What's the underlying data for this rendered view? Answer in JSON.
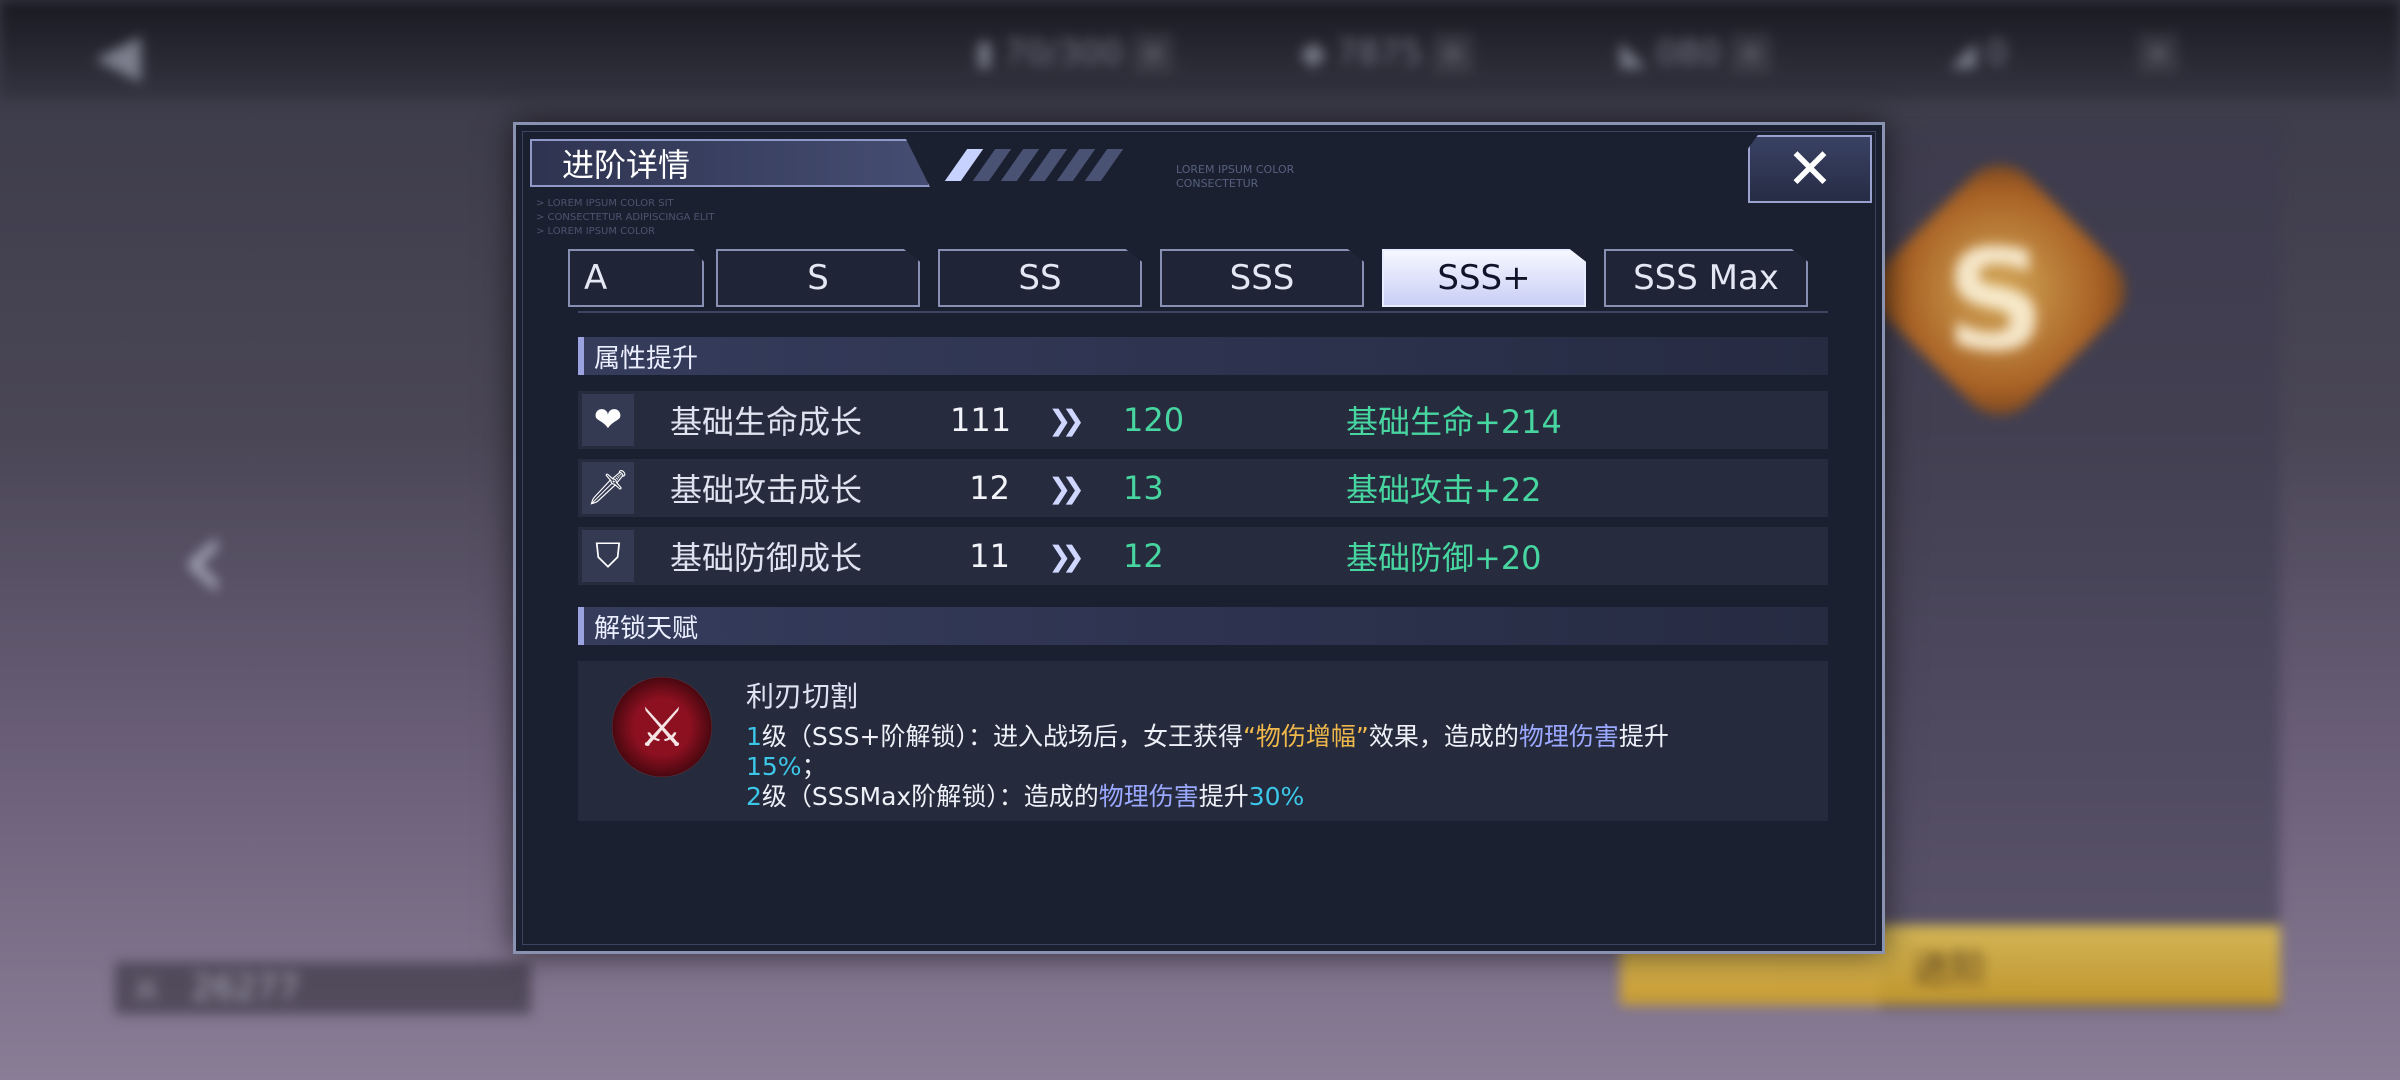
{
  "background": {
    "resources": [
      {
        "value": "70/300",
        "icon": "energy-icon"
      },
      {
        "value": "7875",
        "icon": "gem-icon"
      },
      {
        "value": "080",
        "icon": "ticket-icon"
      },
      {
        "value": "0",
        "icon": "coupon-icon"
      }
    ],
    "rank_letter": "S",
    "advance_button": "进阶",
    "power_value": "26277"
  },
  "modal": {
    "title": "进阶详情",
    "close_label": "✕",
    "tiny_text": "LOREM IPSUM COLOR\nCONSECTETUR",
    "tiny_left": "> LOREM IPSUM COLOR SIT\n> CONSECTETUR ADIPISCINGA ELIT\n> LOREM IPSUM COLOR",
    "tabs": [
      "A",
      "S",
      "SS",
      "SSS",
      "SSS+",
      "SSS Max"
    ],
    "active_tab": "SSS+",
    "attributes_heading": "属性提升",
    "stats": [
      {
        "icon": "heart-icon",
        "label": "基础生命成长",
        "old": "111",
        "new": "120",
        "bonus": "基础生命+214"
      },
      {
        "icon": "sword-icon",
        "label": "基础攻击成长",
        "old": "12",
        "new": "13",
        "bonus": "基础攻击+22"
      },
      {
        "icon": "shield-icon",
        "label": "基础防御成长",
        "old": "11",
        "new": "12",
        "bonus": "基础防御+20"
      }
    ],
    "talent_heading": "解锁天赋",
    "talent": {
      "name": "利刃切割",
      "line1": {
        "level": "1",
        "part_a": "级（SSS+阶解锁）：进入战场后，女王获得",
        "highlight1": "“物伤增幅”",
        "part_b": "效果，造成的",
        "highlight2": "物理伤害",
        "part_c": "提升"
      },
      "line1b": {
        "percent": "15%",
        "tail": "；"
      },
      "line2": {
        "level": "2",
        "part_a": "级（SSSMax阶解锁）：造成的",
        "highlight": "物理伤害",
        "part_b": "提升",
        "percent": "30%"
      }
    }
  },
  "colors": {
    "accent_green": "#47d6a0",
    "accent_cyan": "#3cc7e8",
    "accent_gold": "#f0b84a",
    "accent_blue": "#9aa8ff"
  }
}
